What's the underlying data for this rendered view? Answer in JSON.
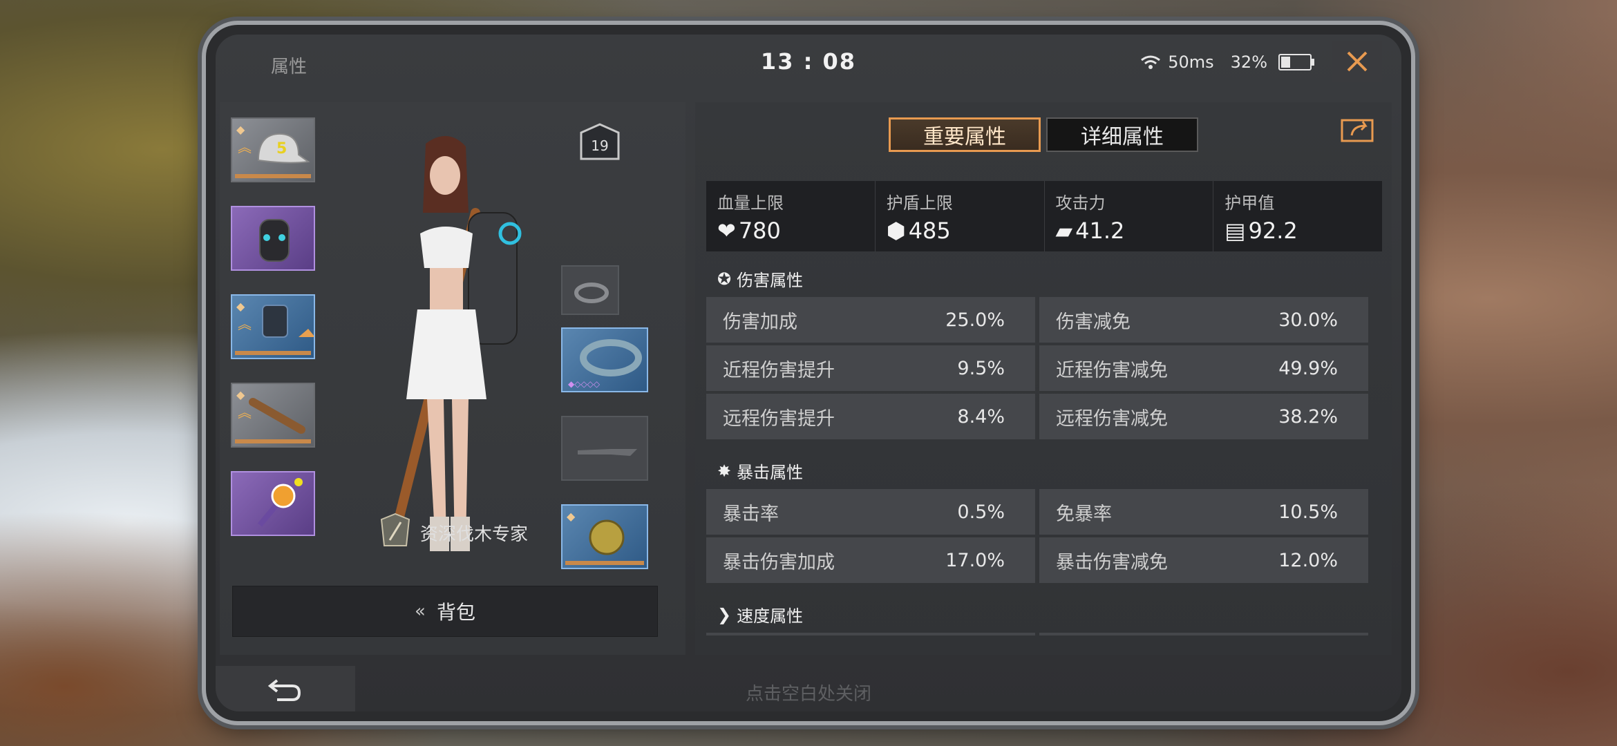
{
  "header": {
    "title": "属性",
    "clock": "13 : 08",
    "ping": "50ms",
    "battery": "32%",
    "battery_level": 0.32
  },
  "equipment": {
    "level": "19",
    "title_text": "资深伐木专家",
    "bag_label": "背包",
    "slots": [
      {
        "name": "cap",
        "rarity": "grey",
        "icon": "baseball-cap-icon"
      },
      {
        "name": "backpack",
        "rarity": "purple",
        "icon": "backpack-icon"
      },
      {
        "name": "armor",
        "rarity": "blue",
        "icon": "armor-vest-icon"
      },
      {
        "name": "bat",
        "rarity": "grey",
        "icon": "baseball-bat-icon"
      },
      {
        "name": "candy-weapon",
        "rarity": "purple",
        "icon": "lollipop-icon"
      },
      {
        "name": "ring",
        "rarity": "empty",
        "icon": "ring-icon"
      },
      {
        "name": "bracelet",
        "rarity": "blue",
        "icon": "bracelet-icon"
      },
      {
        "name": "knife",
        "rarity": "empty",
        "icon": "knife-icon"
      },
      {
        "name": "pet",
        "rarity": "blue",
        "icon": "pet-helmet-icon"
      }
    ]
  },
  "tabs": {
    "important": "重要属性",
    "detailed": "详细属性"
  },
  "summary": [
    {
      "label": "血量上限",
      "value": "780",
      "icon": "heart-icon"
    },
    {
      "label": "护盾上限",
      "value": "485",
      "icon": "shield-icon"
    },
    {
      "label": "攻击力",
      "value": "41.2",
      "icon": "gun-icon"
    },
    {
      "label": "护甲值",
      "value": "92.2",
      "icon": "armor-icon"
    }
  ],
  "sections": {
    "damage": {
      "title": "伤害属性",
      "rows": [
        {
          "label": "伤害加成",
          "value": "25.0%"
        },
        {
          "label": "伤害减免",
          "value": "30.0%"
        },
        {
          "label": "近程伤害提升",
          "value": "9.5%"
        },
        {
          "label": "近程伤害减免",
          "value": "49.9%"
        },
        {
          "label": "远程伤害提升",
          "value": "8.4%"
        },
        {
          "label": "远程伤害减免",
          "value": "38.2%"
        }
      ]
    },
    "crit": {
      "title": "暴击属性",
      "rows": [
        {
          "label": "暴击率",
          "value": "0.5%"
        },
        {
          "label": "免暴率",
          "value": "10.5%"
        },
        {
          "label": "暴击伤害加成",
          "value": "17.0%"
        },
        {
          "label": "暴击伤害减免",
          "value": "12.0%"
        }
      ]
    },
    "speed": {
      "title": "速度属性"
    }
  },
  "footer": {
    "hint": "点击空白处关闭"
  },
  "colors": {
    "accent": "#e89a50",
    "slot_purple": "#8b6ab8",
    "slot_blue": "#5a86b0"
  }
}
